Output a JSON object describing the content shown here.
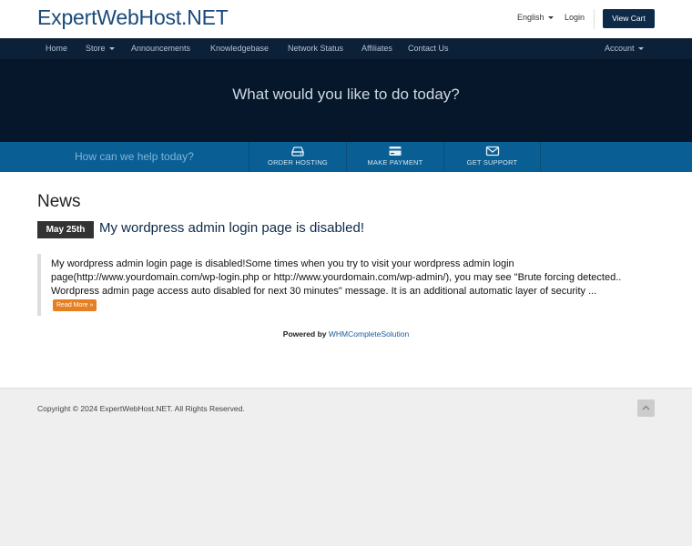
{
  "header": {
    "logo": "ExpertWebHost.NET",
    "language": "English",
    "login": "Login",
    "cart_button": "View Cart"
  },
  "nav": {
    "items": [
      {
        "label": "Home"
      },
      {
        "label": "Store"
      },
      {
        "label": "Announcements"
      },
      {
        "label": "Knowledgebase"
      },
      {
        "label": "Network Status"
      },
      {
        "label": "Affiliates"
      },
      {
        "label": "Contact Us"
      }
    ],
    "account": "Account"
  },
  "hero": {
    "heading": "What would you like to do today?"
  },
  "help_bar": {
    "prompt": "How can we help today?",
    "buttons": [
      {
        "label": "ORDER HOSTING",
        "icon": "hdd-icon"
      },
      {
        "label": "MAKE PAYMENT",
        "icon": "credit-card-icon"
      },
      {
        "label": "GET SUPPORT",
        "icon": "envelope-icon"
      }
    ]
  },
  "news": {
    "title": "News",
    "posts": [
      {
        "date": "May 25th",
        "title": "My wordpress admin login page is disabled!",
        "excerpt": "My wordpress admin login page is disabled!Some times when you try to visit your wordpress admin login page(http://www.yourdomain.com/wp-login.php or http://www.yourdomain.com/wp-admin/), you may see \"Brute forcing detected.. Wordpress admin page access auto disabled for next 30 minutes\" message. It is an additional automatic layer of security ...",
        "read_more": "Read More »"
      }
    ]
  },
  "powered": {
    "prefix": "Powered by",
    "link": "WHMCompleteSolution"
  },
  "footer": {
    "copyright": "Copyright © 2024 ExpertWebHost.NET. All Rights Reserved."
  },
  "colors": {
    "nav_bg": "#0c2037",
    "hero_bg": "#06172b",
    "help_bar_bg": "#095e94",
    "cart_button_bg": "#0d2a48",
    "read_more_bg": "#e67e22"
  }
}
